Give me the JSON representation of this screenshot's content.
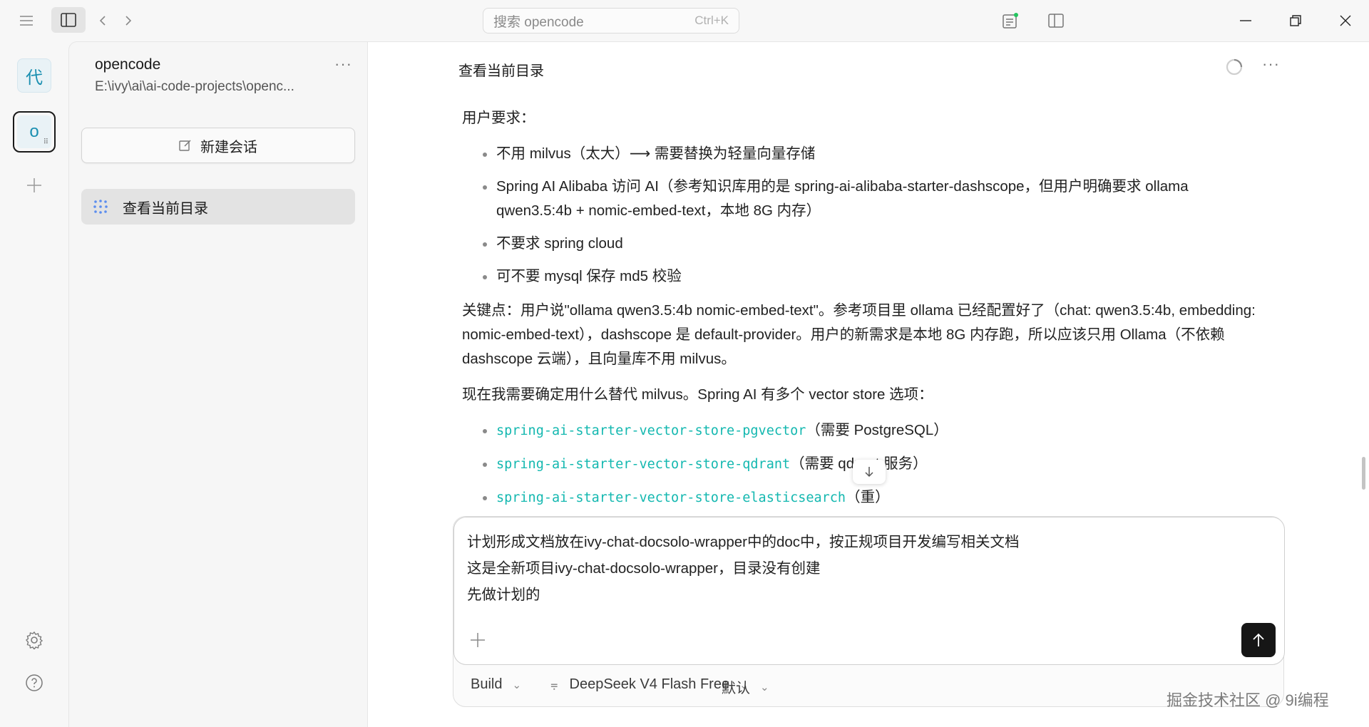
{
  "titlebar": {
    "search_placeholder": "搜索 opencode",
    "search_shortcut": "Ctrl+K"
  },
  "rail": {
    "item1_label": "代",
    "item2_label": "o"
  },
  "sidebar": {
    "project_name": "opencode",
    "project_path": "E:\\ivy\\ai\\ai-code-projects\\openc...",
    "new_session_label": "新建会话",
    "sessions": [
      {
        "label": "查看当前目录"
      }
    ]
  },
  "main": {
    "title": "查看当前目录",
    "paragraphs": {
      "p1": "用户要求：",
      "req1": "不用 milvus（太大）⟶ 需要替换为轻量向量存储",
      "req2": "Spring AI Alibaba 访问 AI（参考知识库用的是 spring-ai-alibaba-starter-dashscope，但用户明确要求 ollama qwen3.5:4b + nomic-embed-text，本地 8G 内存）",
      "req3": "不要求 spring cloud",
      "req4": "可不要 mysql 保存 md5 校验",
      "p2": "关键点：用户说\"ollama qwen3.5:4b nomic-embed-text\"。参考项目里 ollama 已经配置好了（chat: qwen3.5:4b, embedding: nomic-embed-text），dashscope 是 default-provider。用户的新需求是本地 8G 内存跑，所以应该只用 Ollama（不依赖 dashscope 云端），且向量库不用 milvus。",
      "p3": "现在我需要确定用什么替代 milvus。Spring AI 有多个 vector store 选项：",
      "opt1_code": "spring-ai-starter-vector-store-pgvector",
      "opt1_note": "（需要 PostgreSQL）",
      "opt2_code": "spring-ai-starter-vector-store-qdrant",
      "opt2_note": "（需要 qdrant 服务）",
      "opt3_code": "spring-ai-starter-vector-store-elasticsearch",
      "opt3_note": "（重）"
    }
  },
  "composer": {
    "line1": "计划形成文档放在ivy-chat-docsolo-wrapper中的doc中，按正规项目开发编写相关文档",
    "line2": "这是全新项目ivy-chat-docsolo-wrapper，目录没有创建",
    "line3": "先做计划的",
    "agent_label": "Build",
    "model_label": "DeepSeek V4 Flash Free",
    "variant_label": "默认"
  },
  "watermark": "掘金技术社区 @ 9i编程",
  "colors": {
    "code": "#14b8b0",
    "send_button": "#161616",
    "status_dot": "#22c55e"
  }
}
